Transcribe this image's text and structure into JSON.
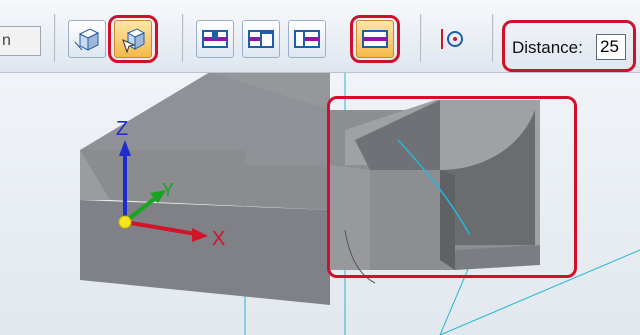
{
  "toolbar": {
    "partial_field_text": "n",
    "distance_label": "Distance:",
    "distance_value": "25",
    "icons": {
      "view_normal": "view-cube-icon",
      "view_select": "view-cube-select-icon",
      "profile_a": "extent-profile-a-icon",
      "profile_b": "extent-profile-b-icon",
      "profile_c": "extent-profile-c-icon",
      "profile_d": "extent-profile-d-icon",
      "keypoint": "keypoint-circle-icon"
    }
  },
  "axes": {
    "z_label": "Z",
    "y_label": "Y",
    "x_label": "X"
  },
  "colors": {
    "highlight": "#d0102a",
    "active_button": "#f5b94a",
    "model_top": "#8f9196",
    "model_front": "#7d7f84",
    "guide_lines": "#27b6d6"
  }
}
